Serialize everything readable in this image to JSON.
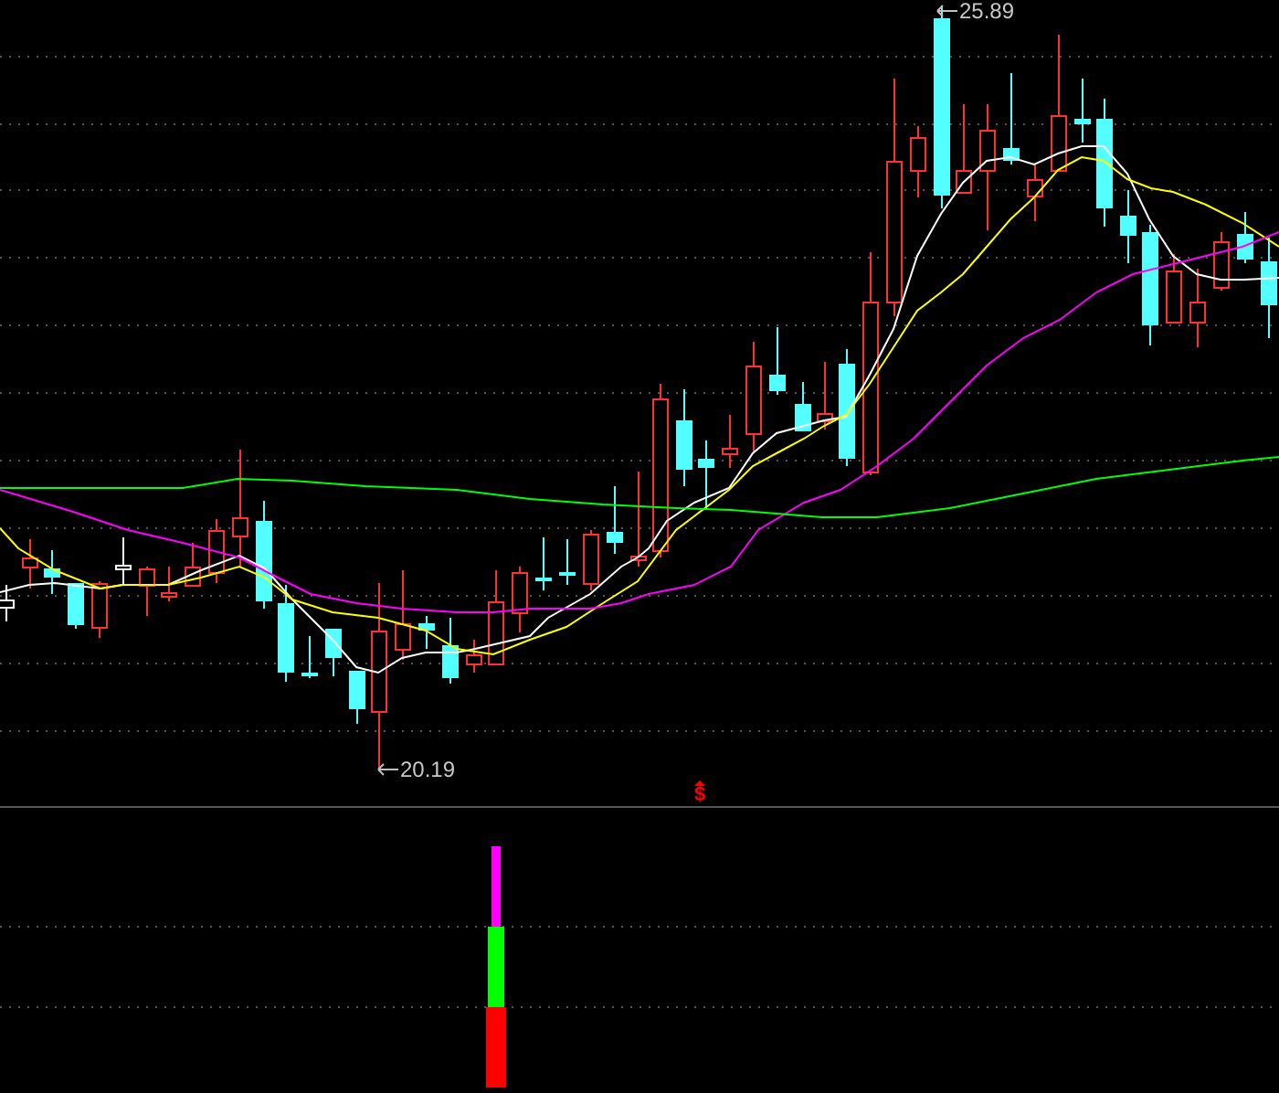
{
  "price_chart": {
    "high_label": "25.89",
    "low_label": "20.19",
    "signal_mark": "$"
  }
}
